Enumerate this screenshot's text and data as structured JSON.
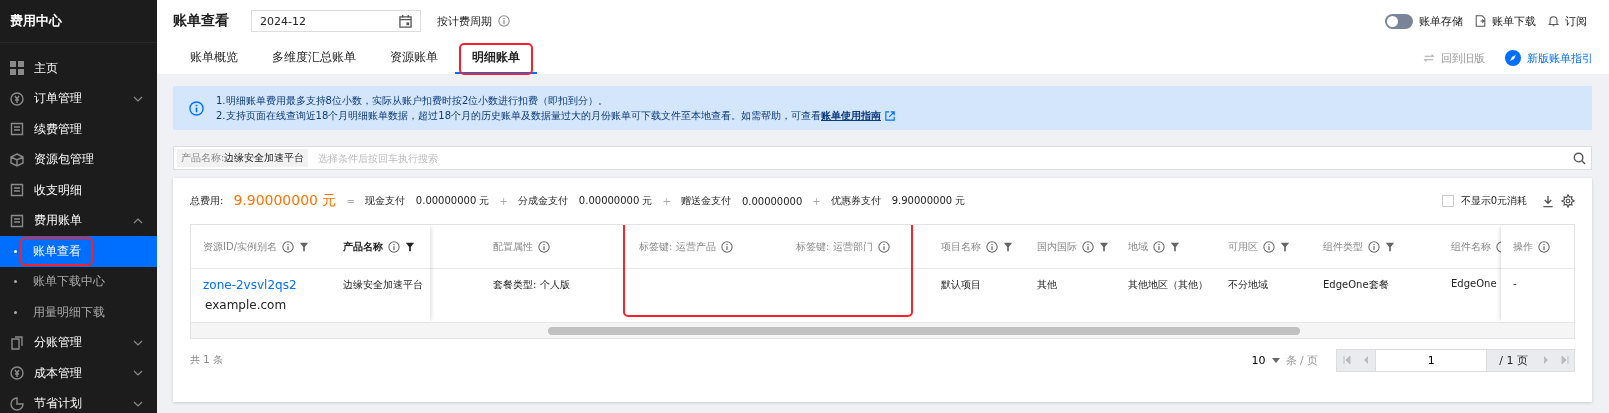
{
  "sidebar": {
    "title": "费用中心",
    "items": [
      {
        "label": "主页"
      },
      {
        "label": "订单管理",
        "expanded": false
      },
      {
        "label": "续费管理"
      },
      {
        "label": "资源包管理"
      },
      {
        "label": "收支明细"
      },
      {
        "label": "费用账单",
        "expanded": true,
        "children": [
          {
            "label": "账单查看",
            "selected": true,
            "highlighted": true
          },
          {
            "label": "账单下载中心",
            "selected": false,
            "highlighted": false
          },
          {
            "label": "用量明细下载",
            "selected": false,
            "highlighted": false
          }
        ]
      },
      {
        "label": "分账管理",
        "expanded": false
      },
      {
        "label": "成本管理",
        "expanded": false
      },
      {
        "label": "节省计划",
        "expanded": false
      }
    ]
  },
  "header": {
    "title": "账单查看",
    "month": "2024-12",
    "period_label": "按计费周期",
    "storage_toggle": {
      "label": "账单存储",
      "on": false
    },
    "download": "账单下载",
    "subscribe": "订阅"
  },
  "tabs": [
    {
      "label": "账单概览",
      "selected": false,
      "highlighted": false
    },
    {
      "label": "多维度汇总账单",
      "selected": false,
      "highlighted": false
    },
    {
      "label": "资源账单",
      "selected": false,
      "highlighted": false
    },
    {
      "label": "明细账单",
      "selected": true,
      "highlighted": true
    }
  ],
  "tab_actions": {
    "old_version": "回到旧版",
    "guide": "新版账单指引"
  },
  "notice": {
    "lines": [
      "1.明细账单费用最多支持8位小数，实际从账户扣费时按2位小数进行扣费（即扣到分）。",
      "2.支持页面在线查询近18个月明细账单数据，超过18个月的历史账单及数据量过大的月份账单可下载文件至本地查看。如需帮助，可查看"
    ],
    "link": "账单使用指南"
  },
  "search": {
    "filter_key": "产品名称:",
    "filter_value": "边缘安全加速平台",
    "placeholder": "选择条件后按回车执行搜索"
  },
  "summary": {
    "label": "总费用:",
    "total": "9.90000000 元",
    "equals": "=",
    "terms": [
      {
        "label": "现金支付",
        "value": "0.00000000 元"
      },
      {
        "label": "分成金支付",
        "value": "0.00000000 元"
      },
      {
        "label": "赠送金支付",
        "value": "0.00000000"
      },
      {
        "label": "优惠券支付",
        "value": "9.90000000 元"
      }
    ],
    "plus": "+",
    "hide_zero": {
      "label": "不显示0元消耗",
      "checked": false
    }
  },
  "table": {
    "columns": [
      {
        "label": "资源ID/实例别名",
        "info": true,
        "filter": true,
        "active": false,
        "highlighted": false
      },
      {
        "label": "产品名称",
        "info": true,
        "filter": true,
        "active": true,
        "highlighted": false
      },
      {
        "label": "配置属性",
        "info": true,
        "filter": false,
        "active": false,
        "highlighted": false
      },
      {
        "label": "标签键: 运营产品",
        "info": true,
        "filter": false,
        "active": false,
        "highlighted": true
      },
      {
        "label": "标签键: 运营部门",
        "info": true,
        "filter": false,
        "active": false,
        "highlighted": true
      },
      {
        "label": "项目名称",
        "info": true,
        "filter": true,
        "active": false,
        "highlighted": false
      },
      {
        "label": "国内国际",
        "info": true,
        "filter": true,
        "active": false,
        "highlighted": false
      },
      {
        "label": "地域",
        "info": true,
        "filter": true,
        "active": false,
        "highlighted": false
      },
      {
        "label": "可用区",
        "info": true,
        "filter": true,
        "active": false,
        "highlighted": false
      },
      {
        "label": "组件类型",
        "info": true,
        "filter": true,
        "active": false,
        "highlighted": false
      },
      {
        "label": "组件名称",
        "info": true,
        "active": false,
        "highlighted": false
      },
      {
        "label": "操作",
        "info": true,
        "filter": false,
        "active": false,
        "highlighted": false
      }
    ],
    "rows": [
      {
        "cells": [
          {
            "link": "zone-2vsvl2qs2",
            "text": "example.com"
          },
          {
            "text": "边缘安全加速平台"
          },
          {
            "text": "套餐类型: 个人版"
          },
          null,
          null,
          {
            "text": "默认项目"
          },
          {
            "text": "其他"
          },
          {
            "text": "其他地区（其他）"
          },
          {
            "text": "不分地域"
          },
          {
            "text": "EdgeOne套餐"
          },
          {
            "text": "EdgeOne"
          },
          {
            "text": "-"
          }
        ]
      }
    ]
  },
  "footer": {
    "total": "共 1 条",
    "page_size": "10",
    "page_size_unit": "条 / 页",
    "page": "1",
    "page_total": "/ 1 页"
  }
}
